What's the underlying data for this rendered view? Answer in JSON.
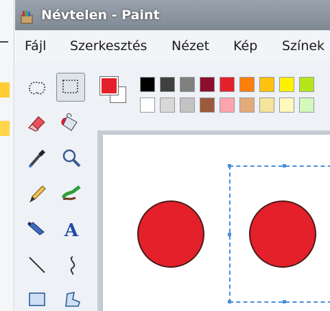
{
  "window": {
    "title": "Névtelen - Paint"
  },
  "menu": {
    "items": [
      "Fájl",
      "Szerkesztés",
      "Nézet",
      "Kép",
      "Színek"
    ]
  },
  "tools": [
    {
      "name": "free-select-tool",
      "icon": "free-select-icon",
      "selected": false
    },
    {
      "name": "rect-select-tool",
      "icon": "rect-select-icon",
      "selected": true
    },
    {
      "name": "eraser-tool",
      "icon": "eraser-icon",
      "selected": false
    },
    {
      "name": "fill-tool",
      "icon": "fill-bucket-icon",
      "selected": false
    },
    {
      "name": "color-picker-tool",
      "icon": "eyedropper-icon",
      "selected": false
    },
    {
      "name": "magnifier-tool",
      "icon": "magnifier-icon",
      "selected": false
    },
    {
      "name": "pencil-tool",
      "icon": "pencil-icon",
      "selected": false
    },
    {
      "name": "brush-tool",
      "icon": "brush-icon",
      "selected": false
    },
    {
      "name": "airbrush-tool",
      "icon": "airbrush-icon",
      "selected": false
    },
    {
      "name": "text-tool",
      "icon": "text-icon",
      "selected": false,
      "glyph": "A"
    },
    {
      "name": "line-tool",
      "icon": "line-icon",
      "selected": false
    },
    {
      "name": "curve-tool",
      "icon": "curve-icon",
      "selected": false
    },
    {
      "name": "rectangle-tool",
      "icon": "rectangle-icon",
      "selected": false
    },
    {
      "name": "polygon-tool",
      "icon": "polygon-icon",
      "selected": false
    }
  ],
  "colors": {
    "foreground": "#e4202b",
    "background": "#ffffff",
    "palette_top": [
      "#000000",
      "#404040",
      "#808080",
      "#8b0e2e",
      "#e4202b",
      "#ff7f0a",
      "#ffc20e",
      "#fff200",
      "#b5e61d"
    ],
    "palette_bottom": [
      "#ffffff",
      "#d8d8d8",
      "#c3c3c3",
      "#9c5a3c",
      "#ffa3b1",
      "#e5aa7a",
      "#f5e49c",
      "#fff9bd",
      "#d3f9bc"
    ]
  },
  "canvas": {
    "shapes": [
      {
        "type": "circle",
        "fill": "#e4202b"
      },
      {
        "type": "circle",
        "fill": "#e4202b"
      }
    ]
  }
}
